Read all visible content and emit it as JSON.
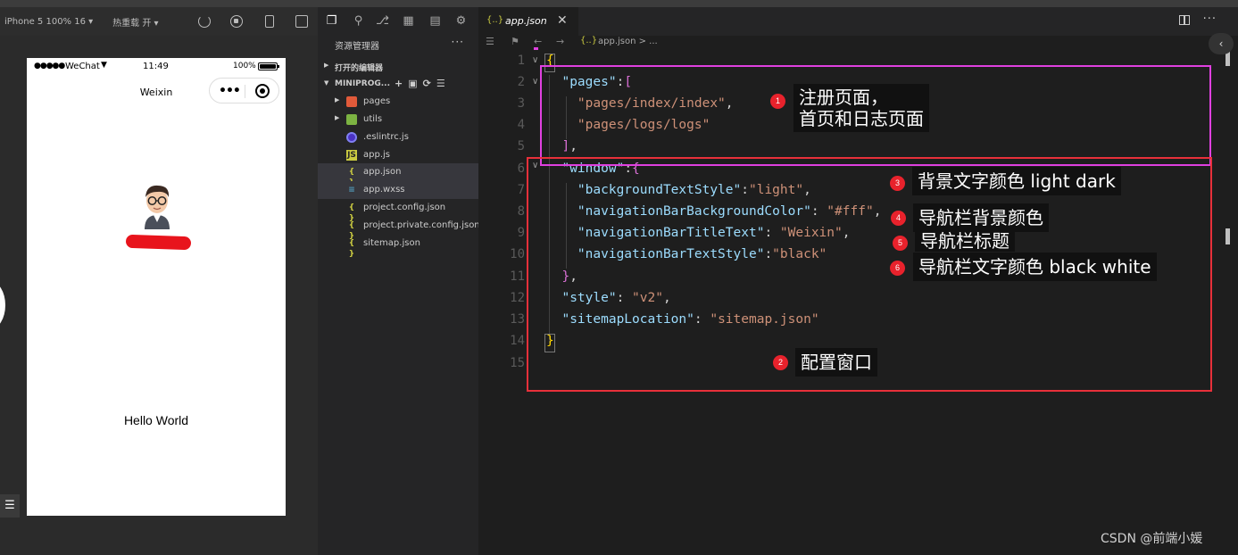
{
  "simulator": {
    "device": "iPhone 5 100% 16 ▾",
    "hot_reload": "热重载 开 ▾",
    "status_bar": {
      "signal": "●●●●●",
      "carrier": "WeChat",
      "time": "11:49",
      "battery": "100%"
    },
    "nav_title": "Weixin",
    "capsule_dots": "•••",
    "hello": "Hello World"
  },
  "explorer": {
    "title": "资源管理器",
    "more": "···",
    "open_editors": "打开的编辑器",
    "project": "MINIPROG...",
    "items": [
      {
        "name": "pages"
      },
      {
        "name": "utils"
      },
      {
        "name": ".eslintrc.js"
      },
      {
        "name": "app.js"
      },
      {
        "name": "app.json"
      },
      {
        "name": "app.wxss"
      },
      {
        "name": "project.config.json"
      },
      {
        "name": "project.private.config.json"
      },
      {
        "name": "sitemap.json"
      }
    ]
  },
  "editor": {
    "tab_label": "app.json",
    "tab_icon": "{..}",
    "breadcrumb": "app.json > ...",
    "line_numbers": [
      "1",
      "2",
      "3",
      "4",
      "5",
      "6",
      "7",
      "8",
      "9",
      "10",
      "11",
      "12",
      "13",
      "14",
      "15"
    ]
  },
  "annotations": [
    {
      "num": "1",
      "text": "注册页面，",
      "text2": "首页和日志页面"
    },
    {
      "num": "2",
      "text": "配置窗口"
    },
    {
      "num": "3",
      "text": "背景文字颜色 light dark"
    },
    {
      "num": "4",
      "text": "导航栏背景颜色"
    },
    {
      "num": "5",
      "text": "导航栏标题"
    },
    {
      "num": "6",
      "text": "导航栏文字颜色 black white"
    }
  ],
  "watermark": "CSDN @前端小媛",
  "colors": {
    "annotation_red": "#e8222c",
    "magenta_box": "#e040e0",
    "json_key": "#9cdcfe",
    "json_string": "#ce9178"
  }
}
